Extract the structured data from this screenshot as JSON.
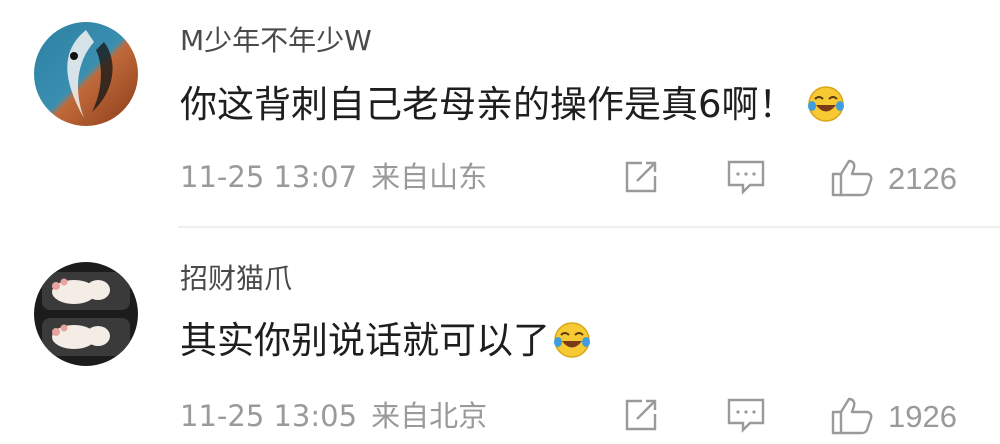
{
  "comments": [
    {
      "username": "M少年不年少W",
      "content": "你这背刺自己老母亲的操作是真6啊！",
      "emoji": "laughing-crying-emoji",
      "time": "11-25 13:07",
      "location": "来自山东",
      "likes": "2126"
    },
    {
      "username": "招财猫爪",
      "content": "其实你别说话就可以了",
      "emoji": "laughing-crying-emoji",
      "time": "11-25 13:05",
      "location": "来自北京",
      "likes": "1926"
    }
  ],
  "icons": {
    "share": "share-icon",
    "reply": "comment-icon",
    "like": "thumbs-up-icon"
  },
  "colors": {
    "text_primary": "#1e1e1e",
    "username": "#4a4a4a",
    "secondary": "#9a9a9a",
    "divider": "#efefef"
  }
}
